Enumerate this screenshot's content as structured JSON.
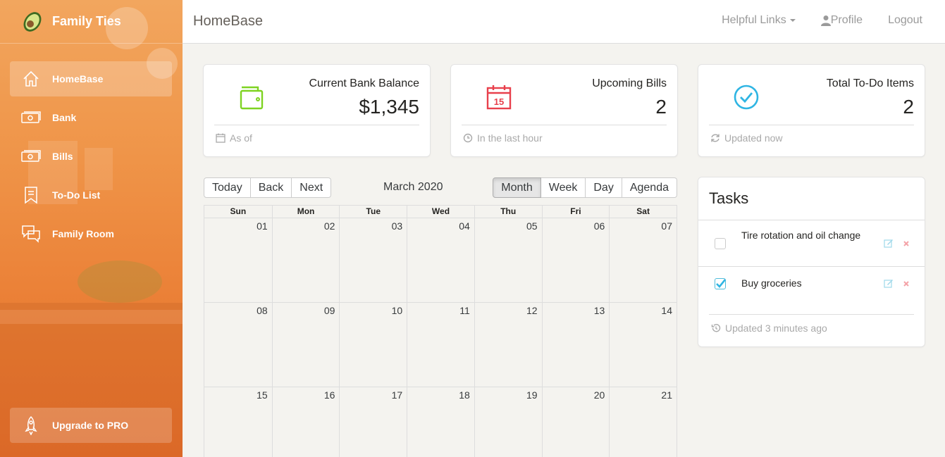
{
  "sidebar": {
    "brand": "Family Ties",
    "items": [
      {
        "label": "HomeBase",
        "icon": "home-icon",
        "active": true
      },
      {
        "label": "Bank",
        "icon": "money-icon"
      },
      {
        "label": "Bills",
        "icon": "money-icon"
      },
      {
        "label": "To-Do List",
        "icon": "bookmark-icon"
      },
      {
        "label": "Family Room",
        "icon": "chat-icon"
      }
    ],
    "upgrade_label": "Upgrade to PRO"
  },
  "header": {
    "title": "HomeBase",
    "links": {
      "helpful": "Helpful Links",
      "profile": "Profile",
      "logout": "Logout"
    }
  },
  "stats": [
    {
      "label": "Current Bank Balance",
      "value": "$1,345",
      "footer": "As of",
      "icon": "wallet-icon",
      "color": "#7ac29a"
    },
    {
      "label": "Upcoming Bills",
      "value": "2",
      "footer": "In the last hour",
      "icon": "calendar-icon",
      "color": "#eb5e28"
    },
    {
      "label": "Total To-Do Items",
      "value": "2",
      "footer": "Updated now",
      "icon": "check-circle-icon",
      "color": "#68b3c8"
    }
  ],
  "calendar": {
    "nav_buttons": [
      "Today",
      "Back",
      "Next"
    ],
    "label": "March 2020",
    "views": [
      "Month",
      "Week",
      "Day",
      "Agenda"
    ],
    "active_view": "Month",
    "weekdays": [
      "Sun",
      "Mon",
      "Tue",
      "Wed",
      "Thu",
      "Fri",
      "Sat"
    ],
    "weeks": [
      [
        "01",
        "02",
        "03",
        "04",
        "05",
        "06",
        "07"
      ],
      [
        "08",
        "09",
        "10",
        "11",
        "12",
        "13",
        "14"
      ],
      [
        "15",
        "16",
        "17",
        "18",
        "19",
        "20",
        "21"
      ]
    ]
  },
  "tasks": {
    "title": "Tasks",
    "items": [
      {
        "text": "Tire rotation and oil change",
        "done": false
      },
      {
        "text": "Buy groceries",
        "done": true
      }
    ],
    "footer": "Updated 3 minutes ago"
  },
  "colors": {
    "accent": "#ef8a40",
    "info": "#51bcda",
    "danger": "#eb5e28",
    "success": "#7ac29a"
  }
}
